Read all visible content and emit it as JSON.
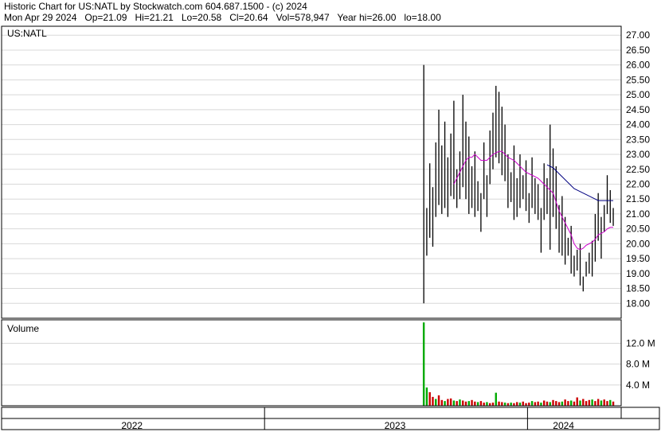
{
  "header": {
    "line1": "Historic Chart for US:NATL by Stockwatch.com 604.687.1500 - (c) 2024",
    "line2": "Mon Apr 29 2024   Op=21.09   Hi=21.21   Lo=20.58   Cl=20.64   Vol=578,947   Year hi=26.00   lo=18.00"
  },
  "chart_data": [
    {
      "type": "line",
      "panel": "price",
      "symbol_label": "US:NATL",
      "ylim": [
        17.5,
        27.3
      ],
      "y_ticks": [
        "27.00",
        "26.50",
        "26.00",
        "25.50",
        "25.00",
        "24.50",
        "24.00",
        "23.50",
        "23.00",
        "22.50",
        "22.00",
        "21.50",
        "21.00",
        "20.50",
        "20.00",
        "19.50",
        "19.00",
        "18.50",
        "18.00"
      ],
      "xlim": [
        "2022-01-01",
        "2024-05-10"
      ],
      "grid": true,
      "colors": {
        "bars": "#000000",
        "ma_short": "#cc00cc",
        "ma_long": "#000080"
      },
      "highs": [
        26.0,
        21.2,
        22.7,
        21.9,
        23.4,
        24.5,
        23.3,
        24.1,
        22.9,
        23.7,
        24.8,
        22.5,
        23.1,
        25.0,
        24.1,
        23.6,
        22.6,
        23.1,
        22.1,
        21.7,
        23.4,
        22.3,
        23.8,
        24.4,
        25.3,
        25.1,
        24.6,
        24.0,
        23.0,
        22.4,
        23.3,
        22.2,
        23.0,
        22.3,
        22.8,
        21.7,
        22.9,
        22.2,
        22.0,
        21.2,
        22.7,
        22.2,
        24.0,
        23.2,
        22.6,
        21.3,
        21.6,
        20.9,
        20.2,
        20.6,
        19.6,
        19.8,
        20.0,
        18.9,
        19.4,
        19.7,
        20.1,
        21.0,
        21.7,
        20.9,
        21.3,
        22.3,
        21.8,
        21.2
      ],
      "lows": [
        18.0,
        19.6,
        20.2,
        19.9,
        20.9,
        21.3,
        21.0,
        21.2,
        20.9,
        21.6,
        21.5,
        21.2,
        21.5,
        21.9,
        21.5,
        21.0,
        21.2,
        20.9,
        21.1,
        20.4,
        21.5,
        20.9,
        22.0,
        22.5,
        22.9,
        22.7,
        22.3,
        22.1,
        21.2,
        21.4,
        20.8,
        20.9,
        21.2,
        21.5,
        21.1,
        20.7,
        21.2,
        21.0,
        20.8,
        19.7,
        20.8,
        21.0,
        19.8,
        20.9,
        20.5,
        19.7,
        19.6,
        19.3,
        19.6,
        19.0,
        18.9,
        19.1,
        18.6,
        18.4,
        18.9,
        19.0,
        18.9,
        19.4,
        20.1,
        19.5,
        20.4,
        21.0,
        20.7,
        20.6
      ],
      "ma_short": [
        null,
        null,
        null,
        null,
        null,
        null,
        null,
        null,
        null,
        null,
        22.0,
        22.2,
        22.4,
        22.6,
        22.8,
        22.9,
        22.9,
        23.0,
        22.9,
        22.8,
        22.8,
        22.8,
        22.9,
        23.0,
        23.05,
        23.1,
        23.1,
        23.0,
        22.9,
        22.85,
        22.8,
        22.7,
        22.6,
        22.5,
        22.4,
        22.35,
        22.3,
        22.25,
        22.2,
        22.1,
        22.0,
        21.9,
        21.8,
        21.7,
        21.4,
        21.1,
        20.9,
        20.7,
        20.5,
        20.3,
        20.0,
        19.85,
        19.8,
        19.85,
        19.95,
        20.0,
        20.05,
        20.15,
        20.3,
        20.35,
        20.4,
        20.5,
        20.55,
        20.55
      ],
      "ma_long": [
        null,
        null,
        null,
        null,
        null,
        null,
        null,
        null,
        null,
        null,
        null,
        null,
        null,
        null,
        null,
        null,
        null,
        null,
        null,
        null,
        null,
        null,
        null,
        null,
        null,
        null,
        null,
        null,
        null,
        null,
        null,
        null,
        null,
        null,
        null,
        null,
        null,
        null,
        null,
        null,
        null,
        22.65,
        22.6,
        22.55,
        22.45,
        22.35,
        22.25,
        22.15,
        22.05,
        21.95,
        21.85,
        21.8,
        21.75,
        21.7,
        21.65,
        21.6,
        21.55,
        21.5,
        21.45,
        21.45,
        21.45,
        21.45,
        21.45,
        21.45
      ]
    },
    {
      "type": "bar",
      "panel": "volume",
      "label": "Volume",
      "y_ticks": [
        "12.0 M",
        "8.0 M",
        "4.0 M"
      ],
      "ylim": [
        0,
        16.5
      ],
      "grid": true,
      "colors": {
        "up": "#00aa00",
        "down": "#cc0000"
      },
      "volumes_m": [
        16.0,
        3.5,
        2.6,
        1.7,
        1.3,
        2.0,
        1.1,
        0.9,
        1.3,
        1.4,
        1.0,
        0.9,
        1.2,
        1.0,
        0.8,
        0.9,
        1.1,
        0.8,
        0.7,
        0.9,
        0.6,
        0.7,
        0.5,
        0.6,
        2.5,
        0.8,
        0.7,
        0.6,
        0.5,
        0.6,
        0.5,
        0.7,
        0.6,
        0.8,
        0.5,
        0.6,
        0.9,
        0.7,
        0.8,
        0.6,
        1.0,
        0.8,
        0.7,
        1.1,
        0.9,
        0.7,
        0.8,
        1.2,
        0.9,
        1.0,
        0.8,
        1.6,
        1.0,
        1.3,
        0.9,
        1.1,
        1.2,
        0.9,
        1.3,
        1.0,
        1.2,
        0.9,
        1.1,
        0.8
      ],
      "up_flags": [
        1,
        1,
        0,
        0,
        1,
        0,
        0,
        1,
        0,
        0,
        1,
        0,
        1,
        0,
        0,
        1,
        0,
        0,
        1,
        0,
        0,
        1,
        0,
        0,
        1,
        0,
        0,
        1,
        0,
        1,
        0,
        0,
        1,
        0,
        0,
        0,
        1,
        0,
        0,
        1,
        0,
        0,
        1,
        0,
        0,
        0,
        1,
        0,
        0,
        1,
        0,
        0,
        1,
        0,
        0,
        0,
        1,
        0,
        0,
        1,
        0,
        0,
        1,
        0
      ]
    }
  ],
  "x_axis": {
    "labels": [
      {
        "text": "2022",
        "date": "2022-07-01"
      },
      {
        "text": "2023",
        "date": "2023-07-01"
      },
      {
        "text": "2024",
        "date": "2024-02-20"
      }
    ],
    "boundaries": [
      "2023-01-01",
      "2024-01-01"
    ]
  },
  "series_dates": {
    "first": "2023-08-10",
    "last": "2024-04-29"
  }
}
